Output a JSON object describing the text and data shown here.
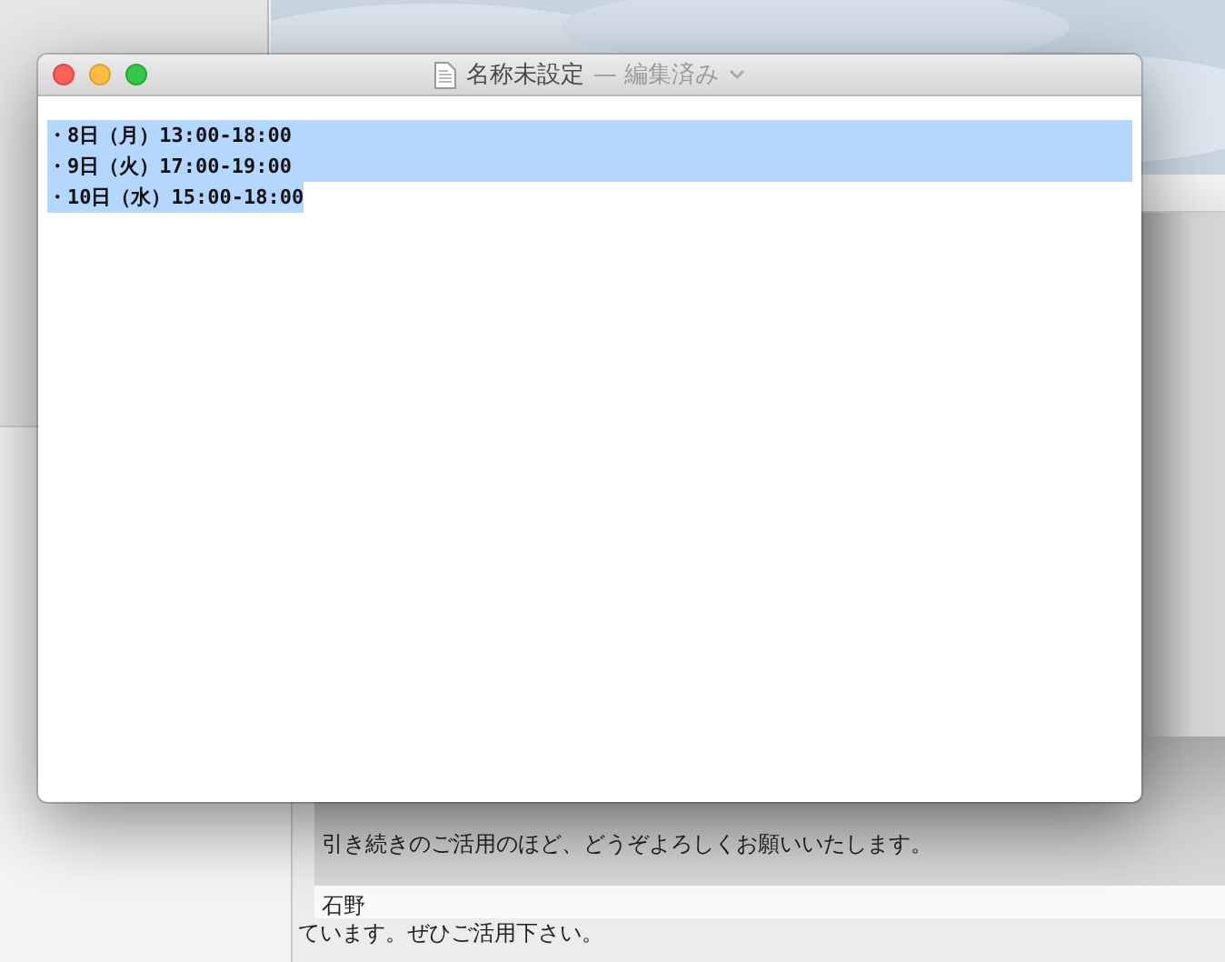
{
  "window": {
    "title": "名称未設定",
    "status": "— 編集済み"
  },
  "document": {
    "lines": [
      {
        "text": "・8日（月）13:00-18:00",
        "selected": true
      },
      {
        "text": "・9日（火）17:00-19:00",
        "selected": true
      },
      {
        "text": "・10日（水）15:00-18:00",
        "selected": true
      }
    ]
  },
  "background_mail": {
    "lines": [
      "引き続きのご活用のほど、どうぞよろしくお願いいたします。"
    ],
    "signature": "石野",
    "footer": "ています。ぜひご活用下さい。"
  }
}
